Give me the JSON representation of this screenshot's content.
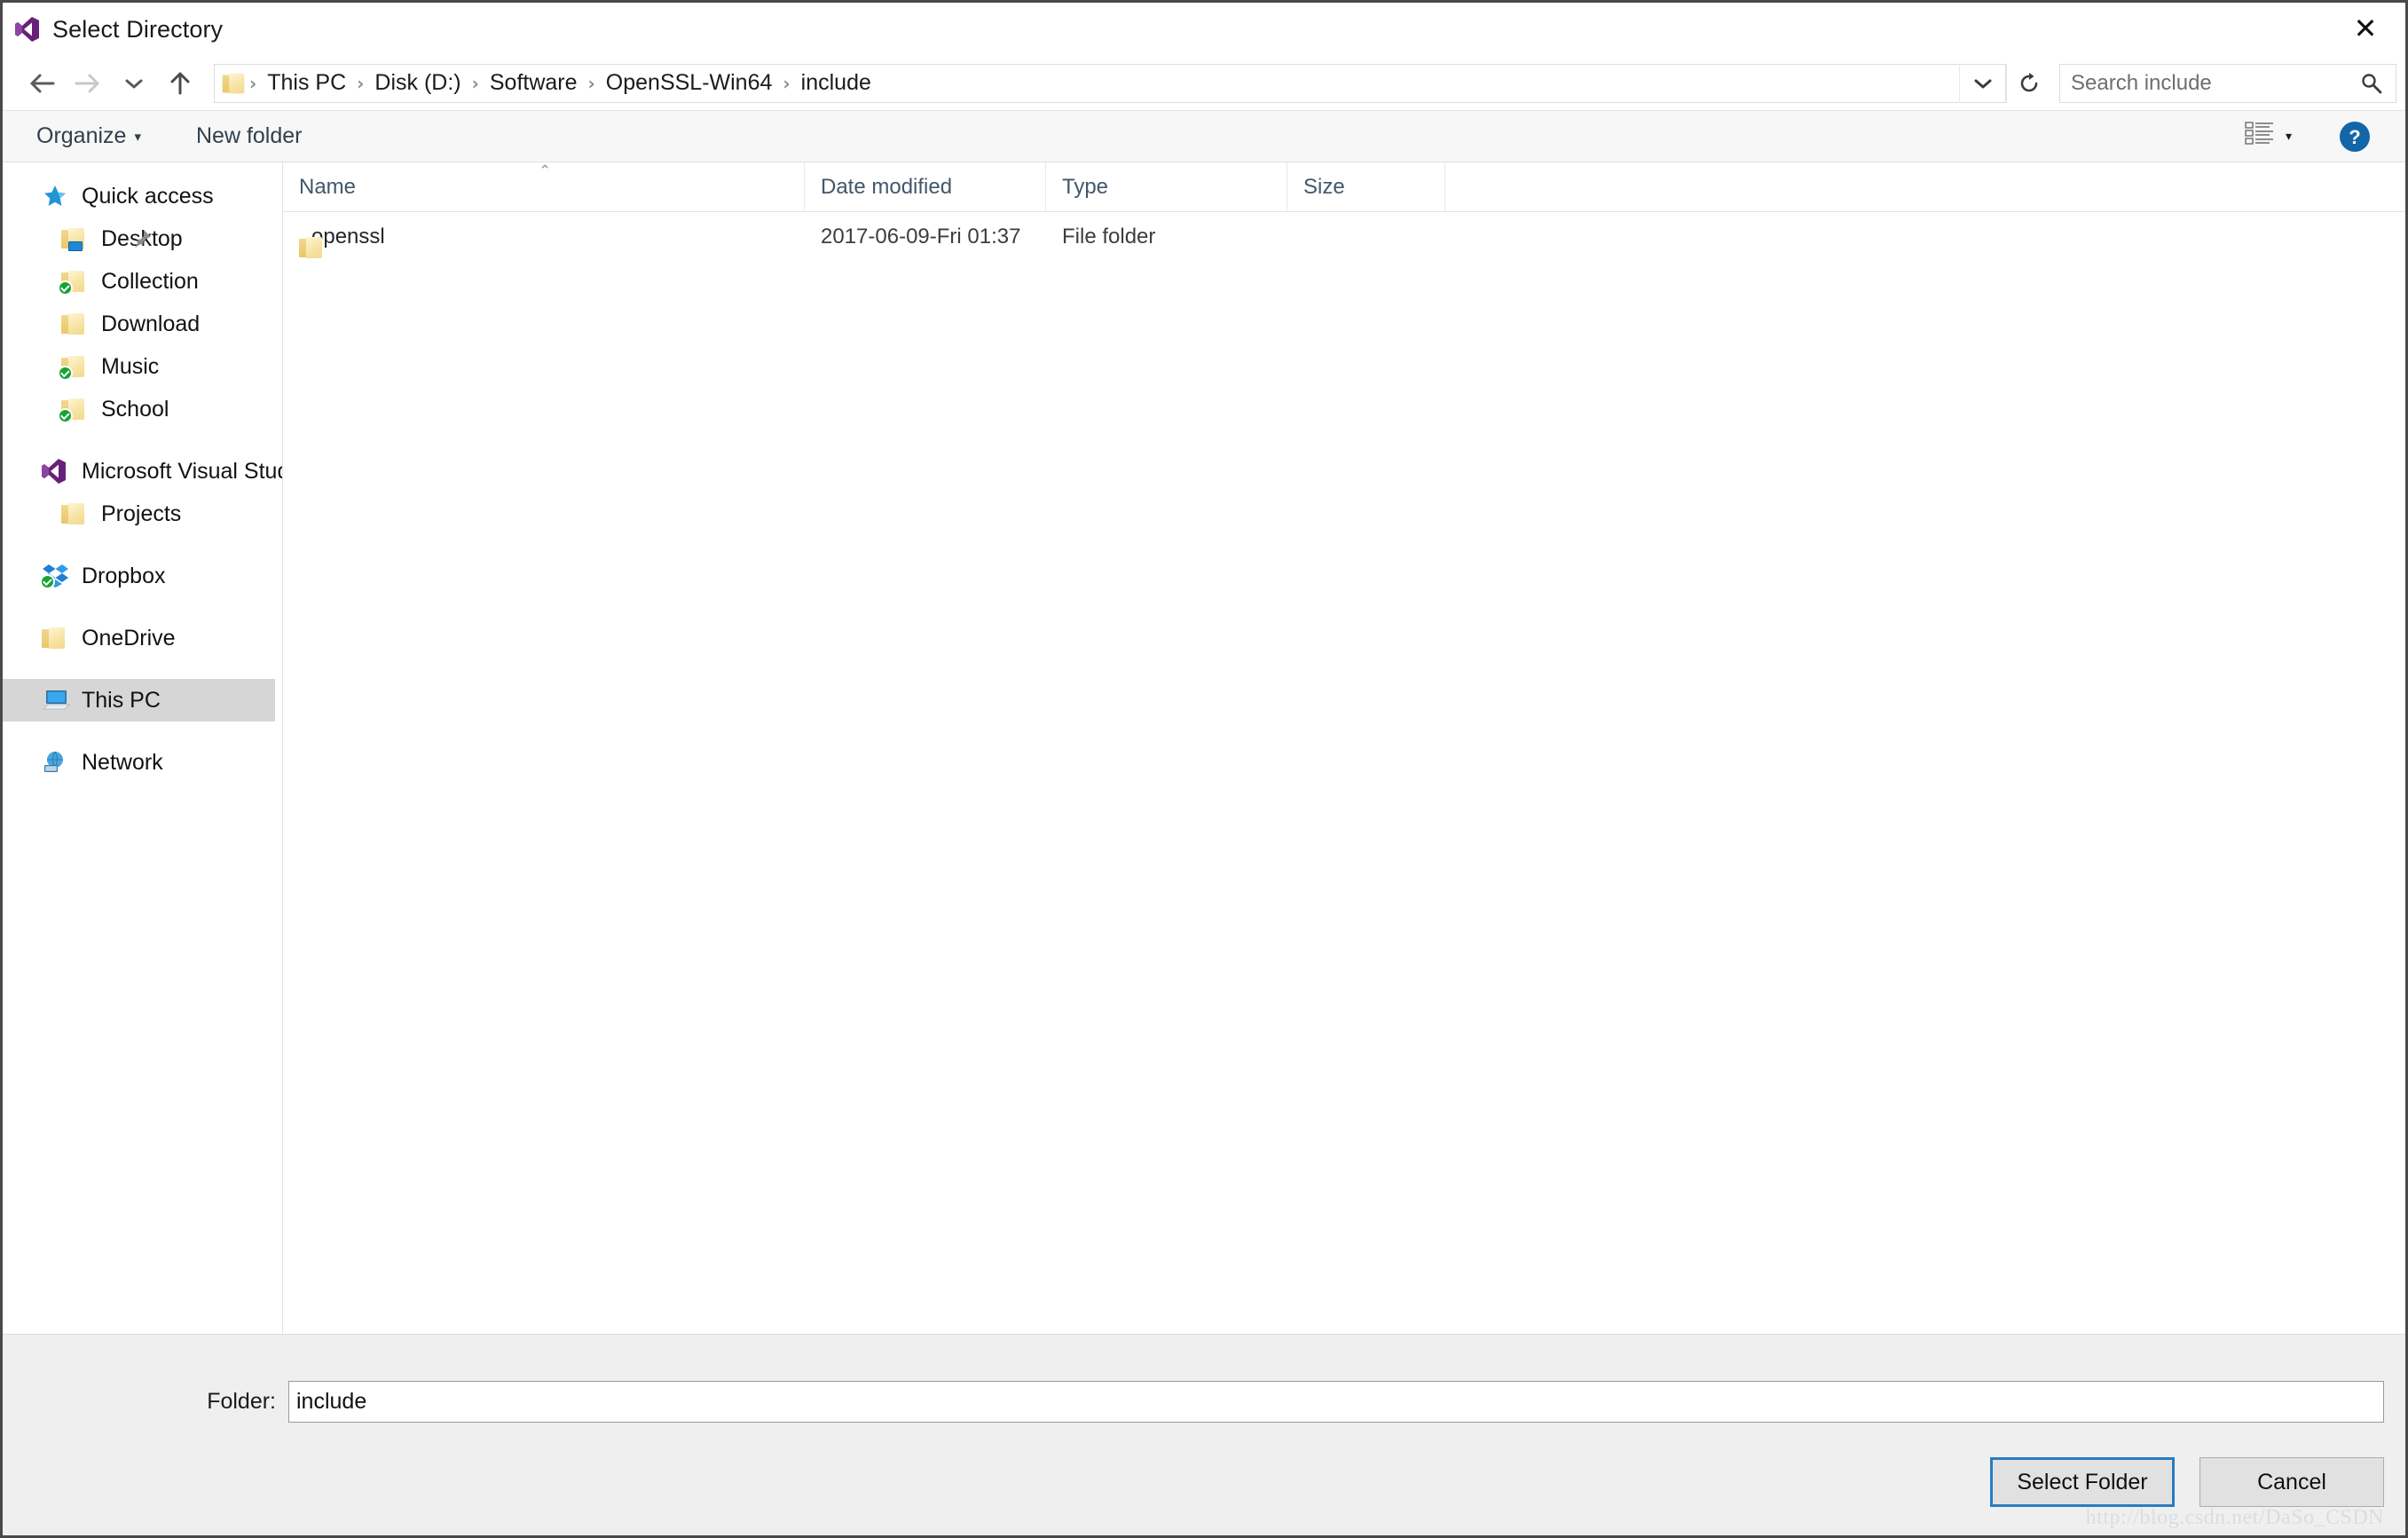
{
  "window": {
    "title": "Select Directory",
    "app_icon": "visual-studio-icon",
    "close_label": "✕"
  },
  "navbar": {
    "back_icon": "arrow-left-icon",
    "forward_icon": "arrow-right-icon",
    "recent_icon": "chevron-down-icon",
    "up_icon": "arrow-up-icon",
    "address_folder_icon": "folder-icon",
    "breadcrumbs": [
      "This PC",
      "Disk (D:)",
      "Software",
      "OpenSSL-Win64",
      "include"
    ],
    "separator": "›",
    "dropdown_icon": "chevron-down-icon",
    "refresh_icon": "refresh-icon",
    "search_placeholder": "Search include",
    "search_value": "",
    "search_icon": "search-icon"
  },
  "toolbar": {
    "organize_label": "Organize",
    "organize_caret": "▾",
    "new_folder_label": "New folder",
    "view_icon": "list-view-icon",
    "view_caret": "▾",
    "help_icon": "help-icon",
    "help_label": "?"
  },
  "sidebar": {
    "items": [
      {
        "label": "Quick access",
        "icon": "star-icon",
        "level": "root",
        "selected": false,
        "pinned": false
      },
      {
        "label": "Desktop",
        "icon": "folder-desktop-icon",
        "level": "child",
        "selected": false,
        "pinned": true
      },
      {
        "label": "Collection",
        "icon": "folder-sync-icon",
        "level": "child",
        "selected": false,
        "pinned": false
      },
      {
        "label": "Download",
        "icon": "folder-icon",
        "level": "child",
        "selected": false,
        "pinned": false
      },
      {
        "label": "Music",
        "icon": "folder-sync-icon",
        "level": "child",
        "selected": false,
        "pinned": false
      },
      {
        "label": "School",
        "icon": "folder-sync-icon",
        "level": "child",
        "selected": false,
        "pinned": false
      },
      {
        "label": "Microsoft Visual Stud",
        "icon": "visual-studio-icon",
        "level": "root",
        "selected": false,
        "pinned": false
      },
      {
        "label": "Projects",
        "icon": "folder-icon",
        "level": "child",
        "selected": false,
        "pinned": false
      },
      {
        "label": "Dropbox",
        "icon": "dropbox-icon",
        "level": "root",
        "selected": false,
        "pinned": false
      },
      {
        "label": "OneDrive",
        "icon": "folder-icon",
        "level": "root",
        "selected": false,
        "pinned": false
      },
      {
        "label": "This PC",
        "icon": "computer-icon",
        "level": "root",
        "selected": true,
        "pinned": false
      },
      {
        "label": "Network",
        "icon": "network-icon",
        "level": "root",
        "selected": false,
        "pinned": false
      }
    ]
  },
  "file_list": {
    "columns": [
      "Name",
      "Date modified",
      "Type",
      "Size"
    ],
    "sort_caret": "⌃",
    "rows": [
      {
        "name": "openssl",
        "date": "2017-06-09-Fri 01:37",
        "type": "File folder",
        "size": "",
        "icon": "folder-icon"
      }
    ]
  },
  "footer": {
    "folder_label": "Folder:",
    "folder_value": "include",
    "select_button": "Select Folder",
    "cancel_button": "Cancel",
    "watermark": "http://blog.csdn.net/DaSo_CSDN"
  },
  "colors": {
    "accent_blue": "#2a7cbf",
    "selection_gray": "#d6d6d6",
    "toolbar_bg": "#f7f7f7",
    "footer_bg": "#efefef",
    "header_text": "#42576b"
  }
}
